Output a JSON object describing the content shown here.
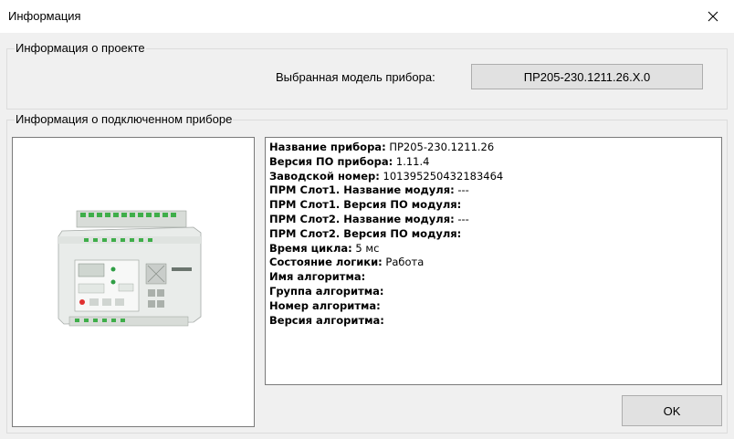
{
  "window": {
    "title": "Информация",
    "close_icon": "close-icon"
  },
  "project_group": {
    "legend": "Информация о проекте",
    "model_label": "Выбранная модель прибора:",
    "model_value": "ПР205-230.1211.26.X.0"
  },
  "device_group": {
    "legend": "Информация о подключенном приборе",
    "image": "device-image",
    "info": [
      {
        "key": "Название прибора:",
        "value": "ПР205-230.1211.26"
      },
      {
        "key": "Версия ПО прибора:",
        "value": "1.11.4"
      },
      {
        "key": "Заводской номер:",
        "value": "101395250432183464"
      },
      {
        "key": "ПРМ Слот1. Название модуля:",
        "value": "---"
      },
      {
        "key": "ПРМ Слот1. Версия ПО модуля:",
        "value": ""
      },
      {
        "key": "ПРМ Слот2. Название модуля:",
        "value": "---"
      },
      {
        "key": "ПРМ Слот2. Версия ПО модуля:",
        "value": ""
      },
      {
        "key": "Время цикла:",
        "value": "5 мс"
      },
      {
        "key": "Состояние логики:",
        "value": "Работа"
      },
      {
        "key": "Имя алгоритма:",
        "value": ""
      },
      {
        "key": "Группа алгоритма:",
        "value": ""
      },
      {
        "key": "Номер алгоритма:",
        "value": ""
      },
      {
        "key": "Версия алгоритма:",
        "value": ""
      }
    ]
  },
  "buttons": {
    "ok_label": "OK"
  }
}
